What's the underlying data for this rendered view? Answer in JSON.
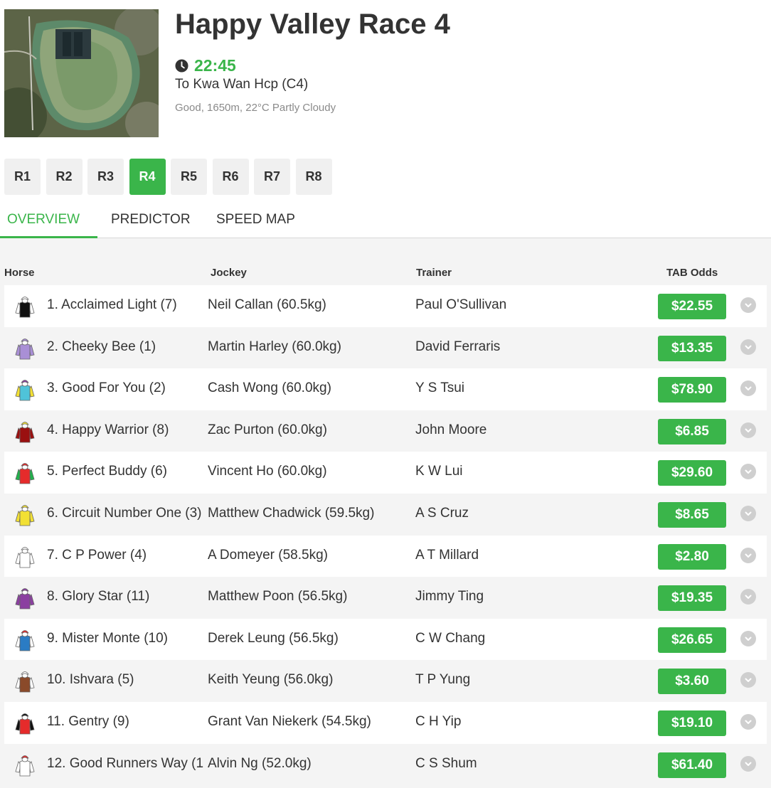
{
  "race": {
    "title": "Happy Valley Race 4",
    "time": "22:45",
    "name": "To Kwa Wan Hcp (C4)",
    "conditions": "Good, 1650m, 22°C Partly Cloudy"
  },
  "race_tabs": [
    "R1",
    "R2",
    "R3",
    "R4",
    "R5",
    "R6",
    "R7",
    "R8"
  ],
  "active_race_tab": "R4",
  "view_tabs": [
    "OVERVIEW",
    "PREDICTOR",
    "SPEED MAP"
  ],
  "active_view_tab": "OVERVIEW",
  "columns": {
    "horse": "Horse",
    "jockey": "Jockey",
    "trainer": "Trainer",
    "odds": "TAB Odds"
  },
  "runners": [
    {
      "horse": "1. Acclaimed Light (7)",
      "jockey": "Neil Callan (60.5kg)",
      "trainer": "Paul O'Sullivan",
      "odds": "$22.55",
      "silk_body": "#111111",
      "silk_sleeves": "#ffffff",
      "silk_cap": "#ffffff"
    },
    {
      "horse": "2. Cheeky Bee (1)",
      "jockey": "Martin Harley (60.0kg)",
      "trainer": "David Ferraris",
      "odds": "$13.35",
      "silk_body": "#a98fd6",
      "silk_sleeves": "#a98fd6",
      "silk_cap": "#a98fd6"
    },
    {
      "horse": "3. Good For You (2)",
      "jockey": "Cash Wong (60.0kg)",
      "trainer": "Y S Tsui",
      "odds": "$78.90",
      "silk_body": "#4fc3d9",
      "silk_sleeves": "#f2e033",
      "silk_cap": "#8b3fa0"
    },
    {
      "horse": "4. Happy Warrior (8)",
      "jockey": "Zac Purton (60.0kg)",
      "trainer": "John Moore",
      "odds": "$6.85",
      "silk_body": "#9a1010",
      "silk_sleeves": "#9a1010",
      "silk_cap": "#f2e033"
    },
    {
      "horse": "5. Perfect Buddy (6)",
      "jockey": "Vincent Ho (60.0kg)",
      "trainer": "K W Lui",
      "odds": "$29.60",
      "silk_body": "#e52b2b",
      "silk_sleeves": "#22b14c",
      "silk_cap": "#e52b2b"
    },
    {
      "horse": "6. Circuit Number One (3)",
      "jockey": "Matthew Chadwick (59.5kg)",
      "trainer": "A S Cruz",
      "odds": "$8.65",
      "silk_body": "#f2e033",
      "silk_sleeves": "#f2e033",
      "silk_cap": "#f2e033"
    },
    {
      "horse": "7. C P Power (4)",
      "jockey": "A Domeyer (58.5kg)",
      "trainer": "A T Millard",
      "odds": "$2.80",
      "silk_body": "#ffffff",
      "silk_sleeves": "#ffffff",
      "silk_cap": "#ffffff"
    },
    {
      "horse": "8. Glory Star (11)",
      "jockey": "Matthew Poon (56.5kg)",
      "trainer": "Jimmy Ting",
      "odds": "$19.35",
      "silk_body": "#8b3fa0",
      "silk_sleeves": "#8b3fa0",
      "silk_cap": "#8b3fa0"
    },
    {
      "horse": "9. Mister Monte (10)",
      "jockey": "Derek Leung (56.5kg)",
      "trainer": "C W Chang",
      "odds": "$26.65",
      "silk_body": "#2b7cc4",
      "silk_sleeves": "#ffffff",
      "silk_cap": "#e52b2b"
    },
    {
      "horse": "10. Ishvara (5)",
      "jockey": "Keith Yeung (56.0kg)",
      "trainer": "T P Yung",
      "odds": "$3.60",
      "silk_body": "#8a4a2a",
      "silk_sleeves": "#ffffff",
      "silk_cap": "#ffffff"
    },
    {
      "horse": "11. Gentry (9)",
      "jockey": "Grant Van Niekerk (54.5kg)",
      "trainer": "C H Yip",
      "odds": "$19.10",
      "silk_body": "#e52b2b",
      "silk_sleeves": "#111111",
      "silk_cap": "#111111"
    },
    {
      "horse": "12. Good Runners Way (1",
      "jockey": "Alvin Ng (52.0kg)",
      "trainer": "C S Shum",
      "odds": "$61.40",
      "silk_body": "#ffffff",
      "silk_sleeves": "#ffffff",
      "silk_cap": "#e52b2b"
    }
  ],
  "colors": {
    "accent": "#3ab54a",
    "tab_bg": "#f0f0f0",
    "text": "#333333",
    "muted": "#8a8a8a"
  }
}
